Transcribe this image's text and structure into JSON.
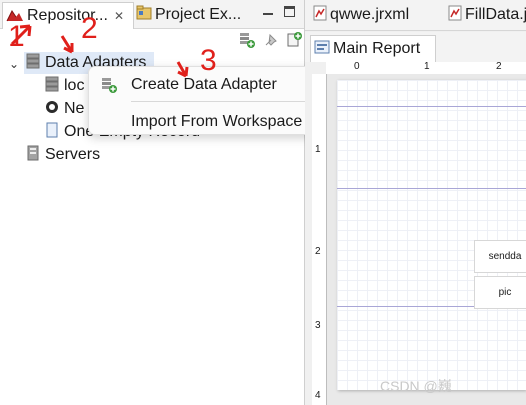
{
  "left_pane": {
    "tabs": [
      {
        "label": "Repositor..."
      },
      {
        "label": "Project Ex..."
      }
    ],
    "close_glyph": "✕"
  },
  "tree": {
    "data_adapters": "Data Adapters",
    "child_1": "loc",
    "child_2": "Ne",
    "child_3": "One Empty Record",
    "servers": "Servers"
  },
  "context_menu": {
    "create": "Create Data Adapter",
    "import": "Import From Workspace"
  },
  "annotations": {
    "n1": "1",
    "n2": "2",
    "n3": "3"
  },
  "editor": {
    "tabs": [
      {
        "label": "qwwe.jrxml"
      },
      {
        "label": "FillData.j"
      }
    ],
    "subtab": "Main Report",
    "ruler_top_marks": [
      "0",
      "1",
      "2"
    ],
    "ruler_left_marks": [
      "1",
      "2",
      "3",
      "4"
    ],
    "fields": [
      "sendda",
      "pic"
    ]
  },
  "watermark": "CSDN @巍 "
}
